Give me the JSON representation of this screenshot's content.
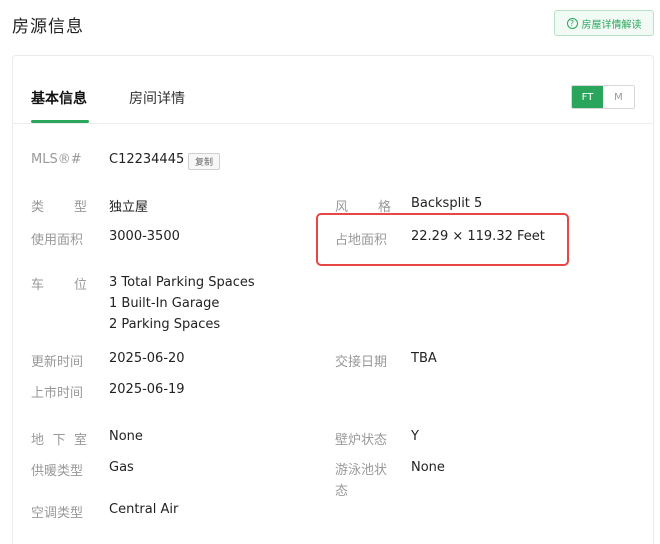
{
  "page": {
    "title": "房源信息",
    "guide_button": "房屋详情解读",
    "guide_icon": "question-circle-icon"
  },
  "tabs": [
    {
      "label": "基本信息",
      "active": true
    },
    {
      "label": "房间详情",
      "active": false
    }
  ],
  "unit_toggle": {
    "ft": "FT",
    "m": "M",
    "selected": "FT"
  },
  "mls": {
    "label": "MLS®#",
    "value": "C12234445",
    "copy_label": "复制"
  },
  "fields": {
    "type": {
      "label_a": "类",
      "label_b": "型",
      "value": "独立屋"
    },
    "style": {
      "label_a": "风",
      "label_b": "格",
      "value": "Backsplit 5"
    },
    "area": {
      "label": "使用面积",
      "value": "3000-3500"
    },
    "lot": {
      "label": "占地面积",
      "value": "22.29 × 119.32 Feet"
    },
    "parking": {
      "label_a": "车",
      "label_b": "位",
      "lines": [
        "3 Total Parking Spaces",
        "1 Built-In Garage",
        "2 Parking Spaces"
      ]
    },
    "updated": {
      "label": "更新时间",
      "value": "2025-06-20"
    },
    "possession": {
      "label": "交接日期",
      "value": "TBA"
    },
    "listed": {
      "label": "上市时间",
      "value": "2025-06-19"
    },
    "basement": {
      "label_a": "地",
      "label_b": "下",
      "label_c": "室",
      "value": "None"
    },
    "fireplace": {
      "label": "壁炉状态",
      "value": "Y"
    },
    "heating": {
      "label": "供暖类型",
      "value": "Gas"
    },
    "pool": {
      "label_line1": "游泳池状",
      "label_line2": "态",
      "value": "None"
    },
    "ac": {
      "label": "空调类型",
      "value": "Central Air"
    }
  },
  "colors": {
    "accent": "#2aa65c",
    "highlight": "#e84545"
  }
}
